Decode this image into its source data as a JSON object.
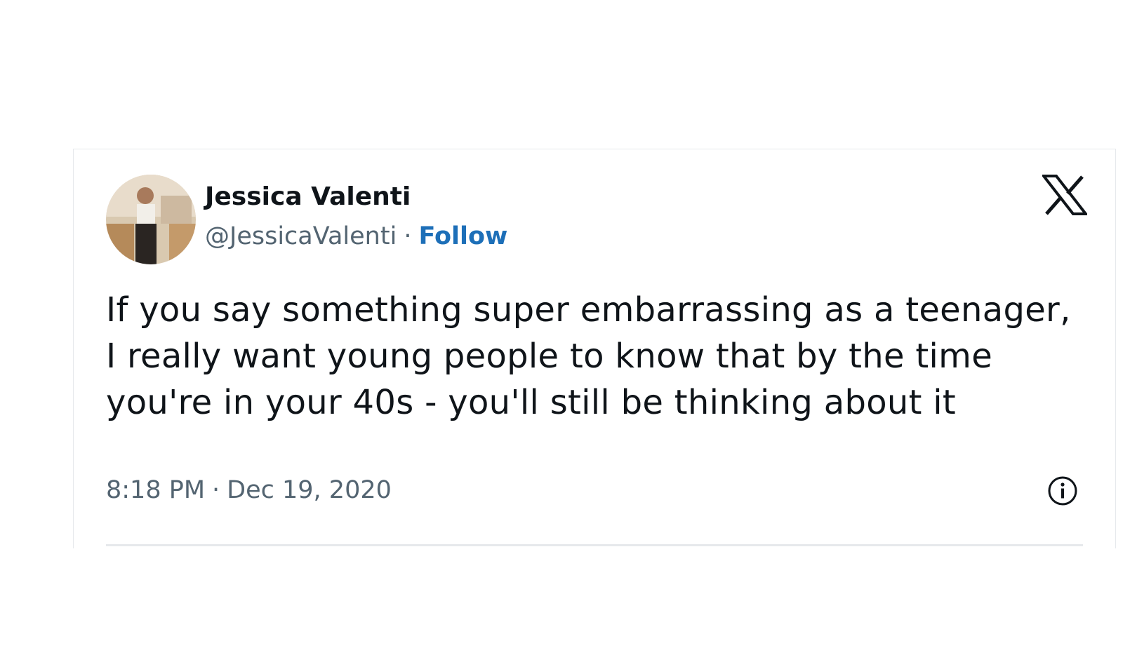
{
  "tweet": {
    "author_name": "Jessica Valenti",
    "handle": "@JessicaValenti",
    "separator": "·",
    "follow_label": "Follow",
    "text": "If you say something super embarrassing as a teenager, I really want young people to know that by the time you're in your 40s - you'll still be thinking about it",
    "time": "8:18 PM",
    "date": "Dec 19, 2020"
  },
  "icons": {
    "brand": "x-logo-icon",
    "info": "info-icon"
  },
  "colors": {
    "follow_link": "#1d6fb8",
    "secondary_text": "#536471",
    "primary_text": "#0f1419",
    "divider": "#e6e9ec"
  }
}
